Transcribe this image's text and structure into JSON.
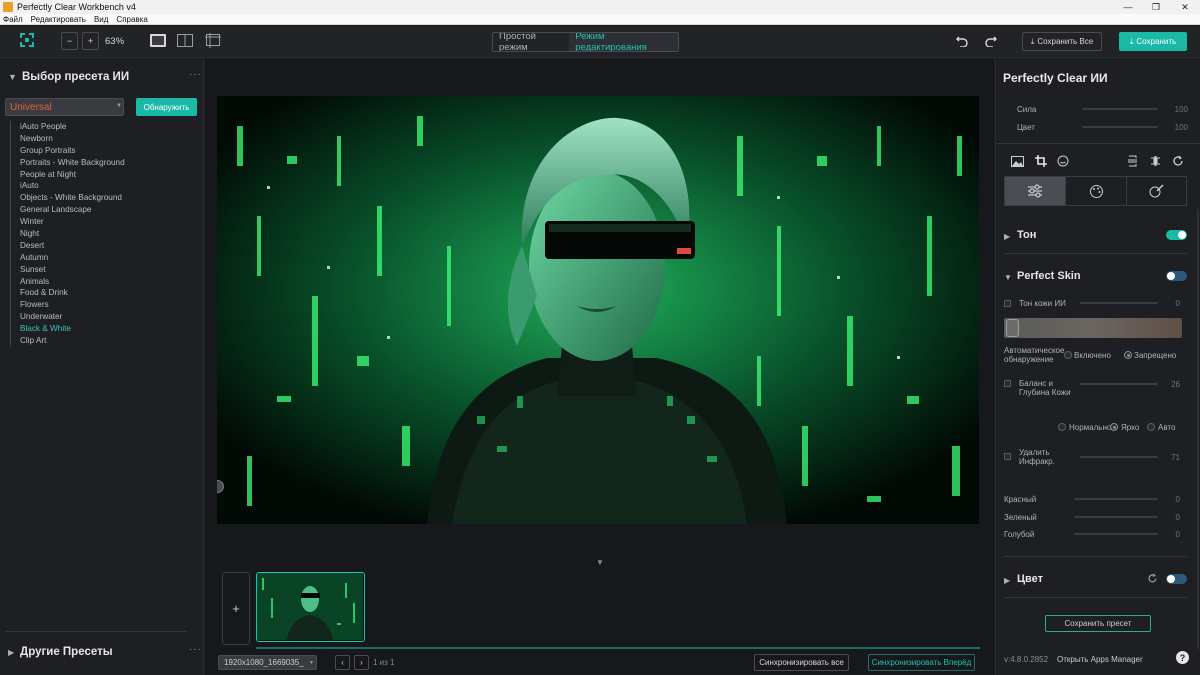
{
  "window": {
    "title": "Perfectly Clear Workbench v4",
    "controls": [
      "—",
      "❐",
      "✕"
    ]
  },
  "menu": [
    "Файл",
    "Редактировать",
    "Вид",
    "Справка"
  ],
  "toolbar": {
    "zoom_minus": "−",
    "zoom_plus": "+",
    "zoom": "63%",
    "mode_simple": "Простой режим",
    "mode_edit": "Режим редактирования",
    "save_all": "Сохранить Все",
    "save": "Сохранить"
  },
  "left": {
    "title": "Выбор пресета ИИ",
    "dropdown": "Universal",
    "detect": "Обнаружить",
    "presets": [
      "iAuto People",
      "Newborn",
      "Group Portraits",
      "Portraits - White Background",
      "People at Night",
      "iAuto",
      "Objects - White Background",
      "General Landscape",
      "Winter",
      "Night",
      "Desert",
      "Autumn",
      "Sunset",
      "Animals",
      "Food & Drink",
      "Flowers",
      "Underwater",
      "Black & White",
      "Clip Art"
    ],
    "active_preset": "Black & White",
    "other_presets": "Другие Пресеты"
  },
  "bottom": {
    "file": "1920x1080_1669035_",
    "page": "1 из 1",
    "sync_all": "Синхронизировать все",
    "sync_next": "Синхронизировать Вперёд",
    "add": "+"
  },
  "right": {
    "title": "Perfectly Clear ИИ",
    "strength_label": "Сила",
    "strength": 100,
    "color_label": "Цвет",
    "color": 100,
    "tone": "Тон",
    "perfect_skin": "Perfect Skin",
    "skin_tone_label": "Тон кожи ИИ",
    "skin_tone": 0,
    "auto_detect": "Автоматическое обнаружение",
    "enabled": "Включено",
    "forbidden": "Запрещено",
    "balance_label": "Баланс и Глубина Кожи",
    "balance": 26,
    "normal": "Нормально",
    "bright": "Ярко",
    "auto": "Авто",
    "remove_ir_label": "Удалить Инфракр.",
    "remove_ir": 71,
    "red_label": "Красный",
    "red": 0,
    "green_label": "Зеленый",
    "green": 0,
    "blue_label": "Голубой",
    "blue": 0,
    "color_section": "Цвет",
    "save_preset": "Сохранить пресет",
    "version": "v:4.8.0.2852",
    "apps_manager": "Открыть Apps Manager",
    "help": "?"
  },
  "colors": {
    "accent": "#19b9a6",
    "dropdown_text": "#e0613a",
    "active_preset": "#35c6b0"
  }
}
